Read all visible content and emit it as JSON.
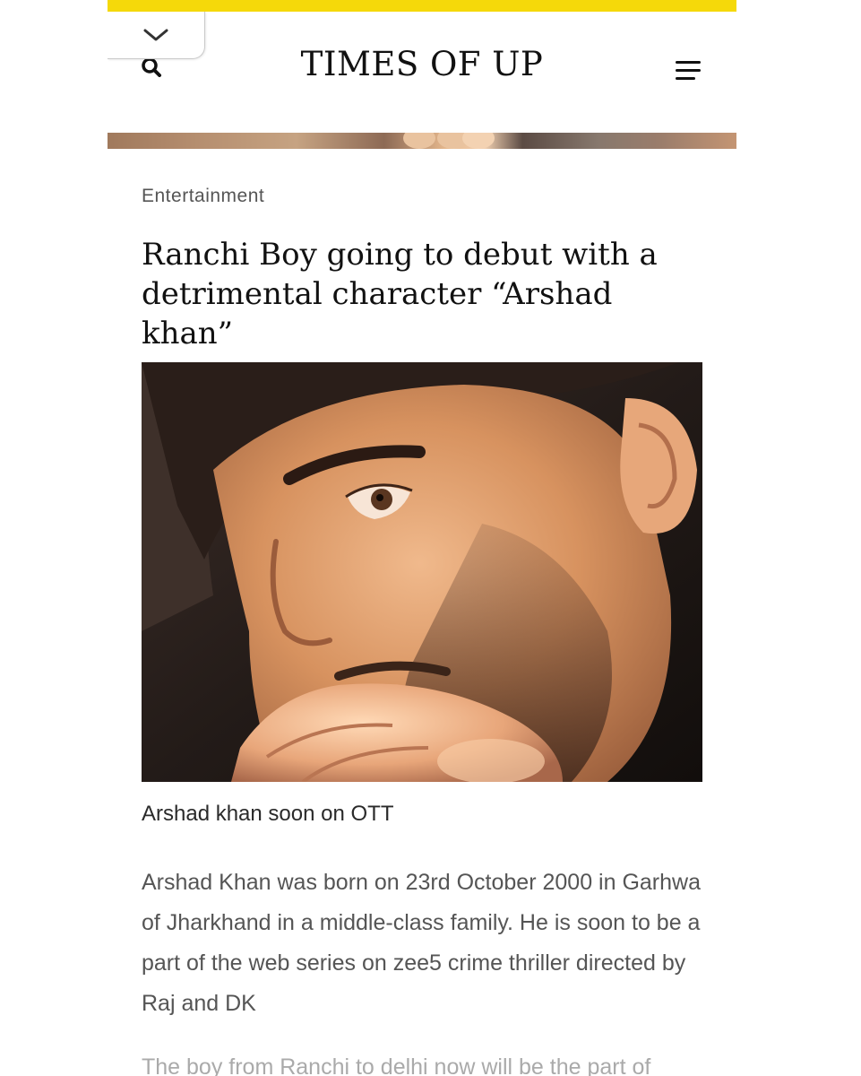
{
  "header": {
    "site_title": "TIMES OF UP",
    "accent_color": "#f5d90a",
    "icons": [
      "chevron-down-icon",
      "search-icon",
      "menu-icon"
    ]
  },
  "article": {
    "category": "Entertainment",
    "headline_line1": "Ranchi Boy going to debut with a",
    "headline_line2": "detrimental character “Arshad khan”",
    "image_caption": "Arshad khan soon on OTT",
    "paragraph1": "Arshad Khan was born on 23rd October 2000 in Garhwa of Jharkhand in a middle-class family. He is soon to be a part of the web series on zee5 crime thriller directed by Raj and DK",
    "paragraph2_partial": "The boy from Ranchi to delhi now will be the part of"
  }
}
